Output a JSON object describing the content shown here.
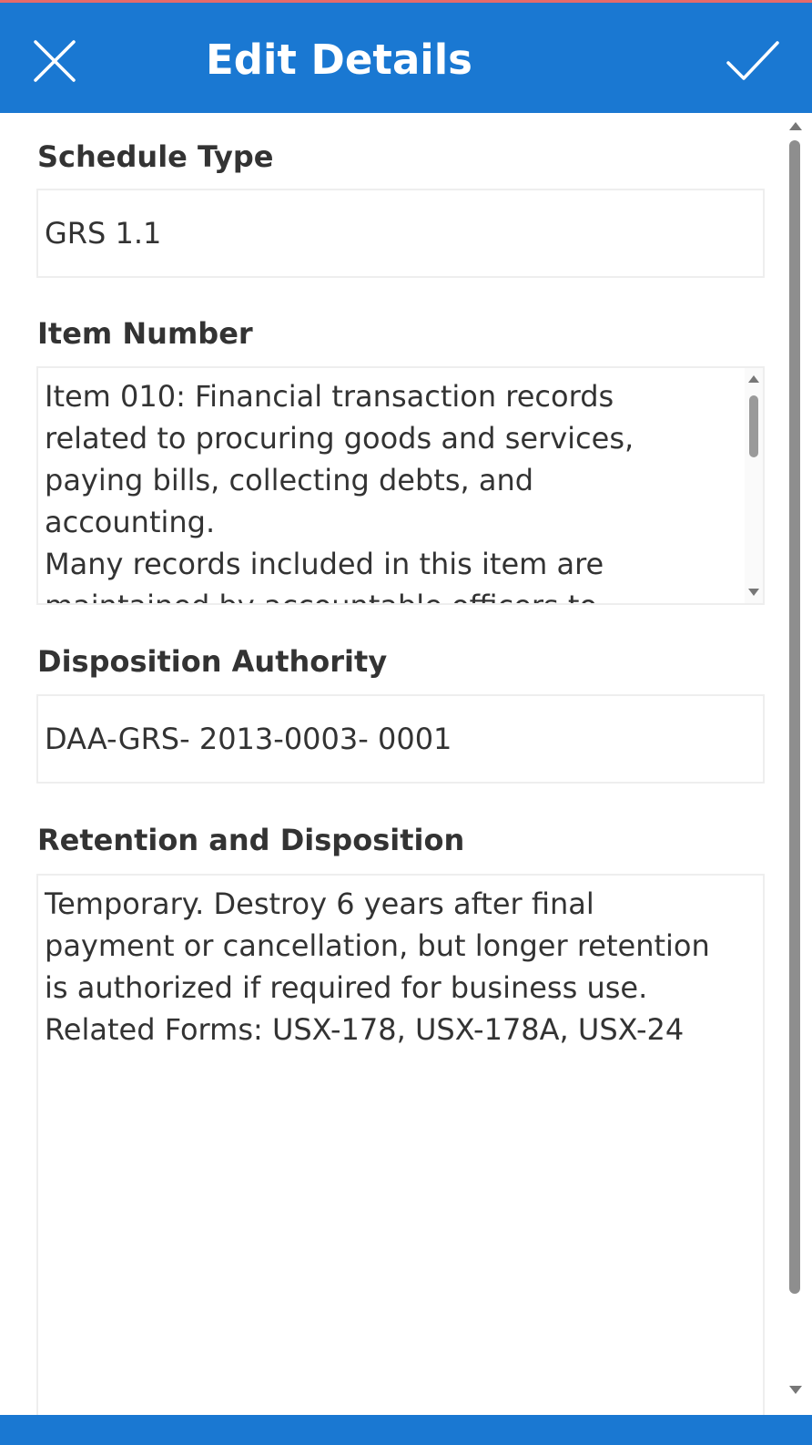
{
  "colors": {
    "header_bg": "#1a78d2",
    "header_text": "#ffffff",
    "accent_top_line": "#e56a6a",
    "label_text": "#333333",
    "field_border": "#eeeeee"
  },
  "header": {
    "title": "Edit Details",
    "close_icon": "close-icon",
    "confirm_icon": "checkmark-icon"
  },
  "form": {
    "schedule_type": {
      "label": "Schedule Type",
      "value": "GRS 1.1"
    },
    "item_number": {
      "label": "Item Number",
      "value": "Item 010: Financial transaction records\nrelated to procuring goods and services,\npaying bills, collecting debts, and\naccounting.\nMany records included in this item are\nmaintained by accountable officers to"
    },
    "disposition_authority": {
      "label": "Disposition Authority",
      "value": "DAA-GRS- 2013-0003- 0001"
    },
    "retention_disposition": {
      "label": "Retention and Disposition",
      "value": "Temporary. Destroy 6 years after final\npayment or cancellation, but longer retention\nis authorized if required for business use.\nRelated Forms: USX-178, USX-178A, USX-24"
    }
  }
}
